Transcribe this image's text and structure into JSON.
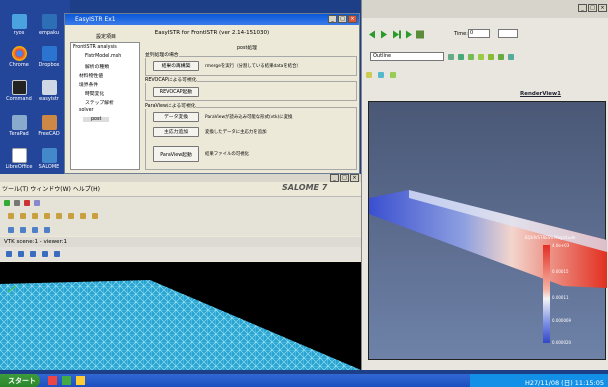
{
  "desktop": {
    "icons": [
      {
        "label": "ryos",
        "color": "#4aa3df"
      },
      {
        "label": "empaku",
        "color": "#2c6fb6"
      },
      {
        "label": "Chrome",
        "color": "#e94335"
      },
      {
        "label": "Dropbox",
        "color": "#2b74d0"
      },
      {
        "label": "Command",
        "color": "#333333"
      },
      {
        "label": "easyistr",
        "color": "#7fa0c8"
      },
      {
        "label": "TeraPad",
        "color": "#9ab"
      },
      {
        "label": "FreeCAD",
        "color": "#c84"
      },
      {
        "label": "LibreOffice",
        "color": "#5a9"
      },
      {
        "label": "SALOME",
        "color": "#48c"
      }
    ]
  },
  "easyistr": {
    "title": "EasyISTR Ex1",
    "header": "EasyISTR for FrontISTR (ver 2.14-151030)",
    "tree_title": "設定項目",
    "tree": [
      "FrontISTR analysis",
      "FistrModel.msh",
      "解析の種類",
      "材料物性値",
      "境界条件",
      "時間変化",
      "ステップ解析",
      "solver",
      "post"
    ],
    "panel_title": "post処理",
    "groups": [
      {
        "title": "並列処理の場合",
        "buttons": [
          {
            "label": "結果の再構築",
            "desc": "rmergeを実行（分割している結果dataを結合）"
          }
        ]
      },
      {
        "title": "REVOCAPによる可視化",
        "buttons": [
          {
            "label": "REVOCAP起動",
            "desc": ""
          }
        ]
      },
      {
        "title": "ParaViewによる可視化",
        "buttons": [
          {
            "label": "データ変換",
            "desc": "ParaViewが読み込み可能な形式(vtk)に変換"
          },
          {
            "label": "主応力追加",
            "desc": "変換したデータに主応力を追加"
          },
          {
            "label": "ParaView起動",
            "desc": "結果ファイルの可視化"
          }
        ]
      }
    ],
    "winbtns": [
      "_",
      "□",
      "×"
    ]
  },
  "salome": {
    "menu": "ツール(T)  ウィンドウ(W)  ヘルプ(H)",
    "logo": "SALOME 7",
    "vtk_title": "VTK scene:1 - viewer:1",
    "winbtns": [
      "_",
      "□",
      "×"
    ]
  },
  "paraview": {
    "time_label": "Time:",
    "time_value": "0",
    "outline_label": "Outline",
    "view_tab": "RenderView1",
    "colorbar_title": "EQUIVSTRESS Magnitude",
    "colorbar_labels": [
      "4.0e+03",
      "0.00015",
      "0.00011",
      "0.000069",
      "0.000020"
    ],
    "winbtns": [
      "_",
      "□",
      "×"
    ]
  },
  "taskbar": {
    "start": "スタート",
    "tray_time": "H27/11/08 (日) 11:15:05"
  }
}
